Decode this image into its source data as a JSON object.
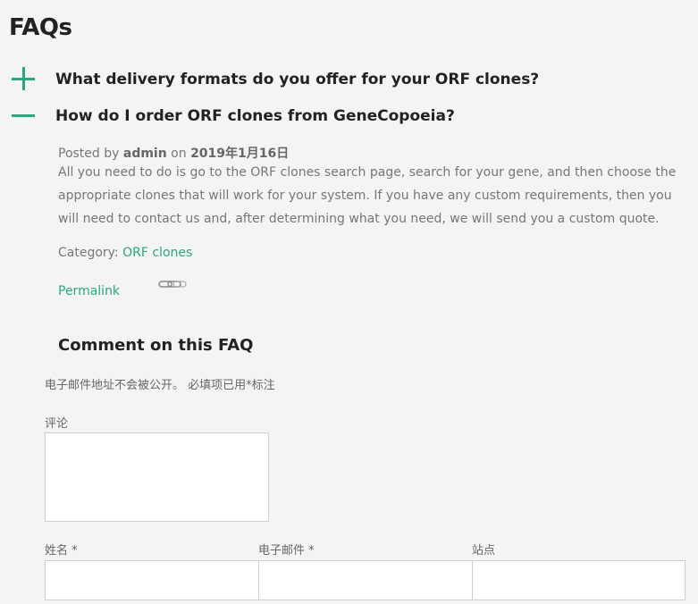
{
  "page": {
    "title": "FAQs"
  },
  "faqs": [
    {
      "toggle": "plus-icon",
      "question": "What delivery formats do you offer for your ORF clones?"
    },
    {
      "toggle": "minus-icon",
      "question": "How do I order ORF clones from GeneCopoeia?"
    }
  ],
  "active": {
    "posted_by_label": "Posted by",
    "author": "admin",
    "on_label": "on",
    "date": "2019年1月16日",
    "answer": "All you need to do is go to the ORF clones search page, search for your gene, and then choose the appropriate clones that will work for your system. If you have any custom requirements, then you will need to contact us and, after determining what you need, we will send you a custom quote.",
    "category_label": "Category:",
    "category": "ORF clones",
    "permalink": "Permalink"
  },
  "comment_form": {
    "heading": "Comment on this FAQ",
    "notice": "电子邮件地址不会被公开。 必填项已用*标注",
    "comment_label": "评论",
    "name_label": "姓名 *",
    "email_label": "电子邮件 *",
    "site_label": "站点"
  },
  "colors": {
    "accent": "#2aa879",
    "heading": "#222222",
    "text": "#777777"
  }
}
